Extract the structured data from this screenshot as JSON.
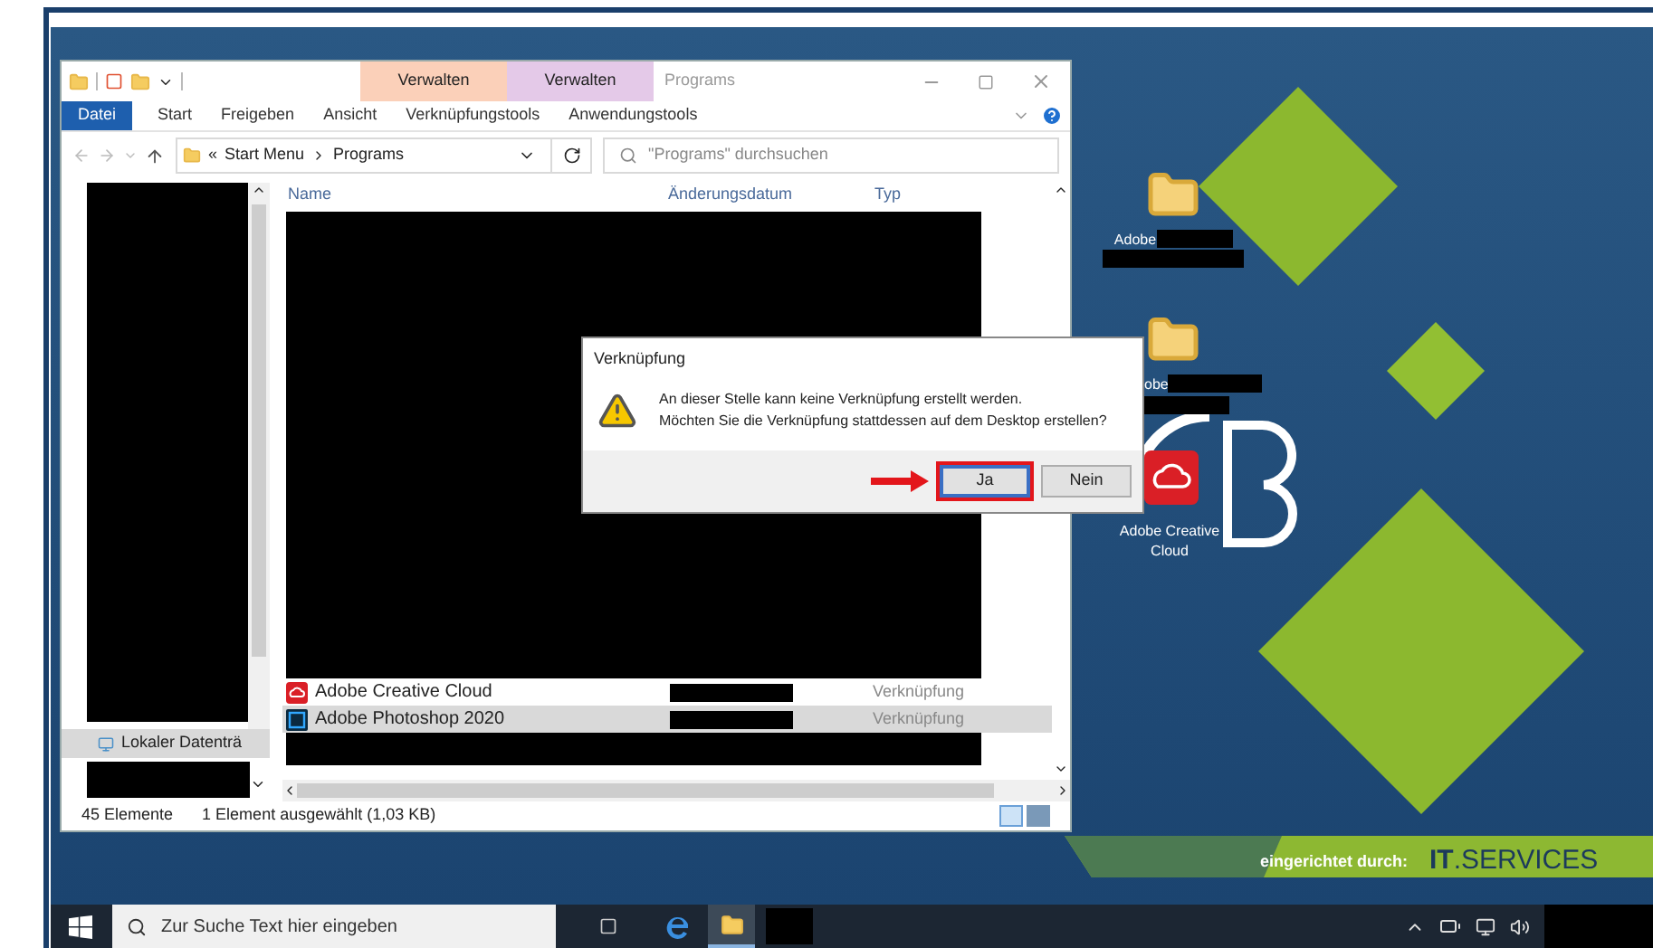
{
  "explorer": {
    "title": "Programs",
    "context_groups": [
      {
        "label": "Verwalten",
        "color": "#fbd0b9"
      },
      {
        "label": "Verwalten",
        "color": "#e4c9e8"
      }
    ],
    "ribbon_tabs": [
      {
        "label": "Datei",
        "kind": "file"
      },
      {
        "label": "Start",
        "kind": "tab"
      },
      {
        "label": "Freigeben",
        "kind": "tab"
      },
      {
        "label": "Ansicht",
        "kind": "tab"
      },
      {
        "label": "Verknüpfungstools",
        "kind": "context"
      },
      {
        "label": "Anwendungstools",
        "kind": "context"
      }
    ],
    "breadcrumb_overflow": "«",
    "breadcrumb": [
      "Start Menu",
      "Programs"
    ],
    "search": {
      "placeholder": "\"Programs\" durchsuchen"
    },
    "nav_items": [
      {
        "label": "Lokaler Datenträ",
        "selected": true
      }
    ],
    "columns": [
      "Name",
      "Änderungsdatum",
      "Typ"
    ],
    "rows": [
      {
        "name": "Adobe Creative Cloud",
        "type": "Verknüpfung",
        "kind": "cc",
        "selected": false
      },
      {
        "name": "Adobe Photoshop 2020",
        "type": "Verknüpfung",
        "kind": "ps",
        "selected": true
      }
    ],
    "status": {
      "count": "45 Elemente",
      "selection": "1 Element ausgewählt (1,03 KB)"
    }
  },
  "dialog": {
    "title": "Verknüpfung",
    "message": [
      "An dieser Stelle kann keine Verknüpfung erstellt werden.",
      "Möchten Sie die Verknüpfung stattdessen auf dem Desktop erstellen?"
    ],
    "buttons": [
      {
        "label": "Ja",
        "selected": true
      },
      {
        "label": "Nein",
        "selected": false
      }
    ]
  },
  "desktop_icons": [
    {
      "label": "Adobe",
      "kind": "folder"
    },
    {
      "label": "obe",
      "kind": "folder"
    },
    {
      "label": "Adobe Creative Cloud",
      "kind": "cc"
    }
  ],
  "banner": {
    "prefix": "eingerichtet durch:",
    "brand": "**IT**.SERVICES"
  },
  "taskbar": {
    "search_placeholder": "Zur Suche Text hier eingeben"
  }
}
